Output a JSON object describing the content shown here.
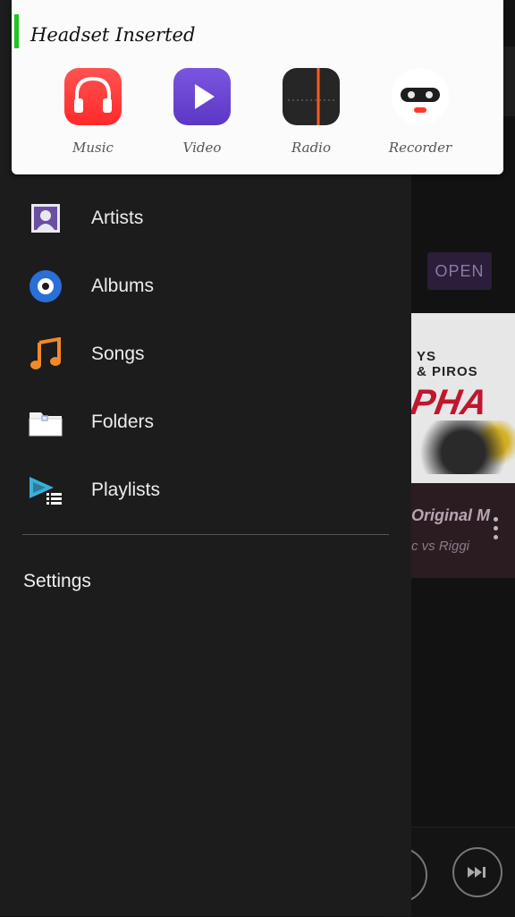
{
  "notification": {
    "title": "Headset Inserted",
    "accent_color": "#20c420",
    "apps": [
      {
        "label": "Music",
        "icon": "headphones-icon"
      },
      {
        "label": "Video",
        "icon": "play-icon"
      },
      {
        "label": "Radio",
        "icon": "radio-dial-icon"
      },
      {
        "label": "Recorder",
        "icon": "recorder-robot-icon"
      }
    ]
  },
  "drawer": {
    "items": [
      {
        "label": "Artists",
        "icon": "artist-portrait-icon"
      },
      {
        "label": "Albums",
        "icon": "album-disc-icon"
      },
      {
        "label": "Songs",
        "icon": "music-note-icon"
      },
      {
        "label": "Folders",
        "icon": "folder-icon"
      },
      {
        "label": "Playlists",
        "icon": "playlist-icon"
      }
    ],
    "settings_label": "Settings"
  },
  "background": {
    "open_button": "OPEN",
    "album_text_1": "YS",
    "album_text_1b": "& PIROS",
    "album_text_2": "PHA",
    "song_title": "Original M",
    "song_artist": "c vs Riggi"
  }
}
